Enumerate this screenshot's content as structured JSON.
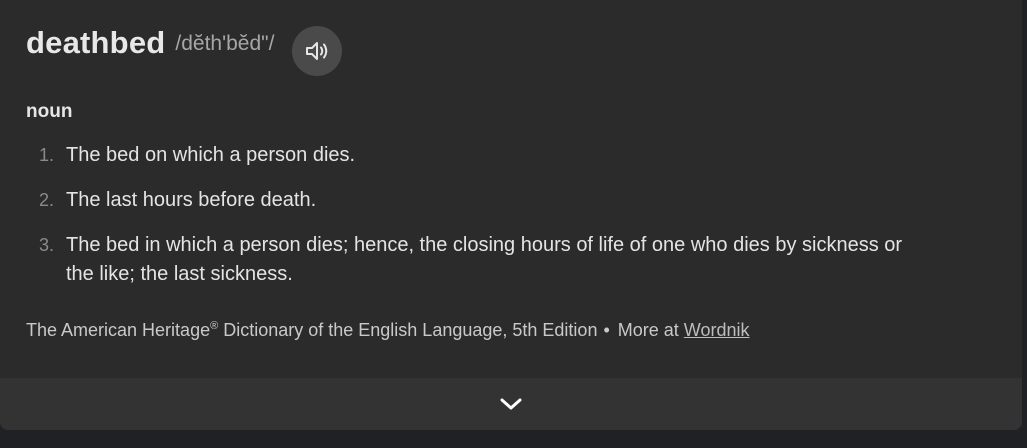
{
  "entry": {
    "word": "deathbed",
    "pronunciation": "/dĕth'bĕd\"/",
    "part_of_speech": "noun"
  },
  "definitions": [
    {
      "number": "1.",
      "text": "The bed on which a person dies."
    },
    {
      "number": "2.",
      "text": "The last hours before death."
    },
    {
      "number": "3.",
      "text": "The bed in which a person dies; hence, the closing hours of life of one who dies by sickness or the like; the last sickness."
    }
  ],
  "source": {
    "name_prefix": "The American Heritage",
    "registered": "®",
    "name_suffix": " Dictionary of the English Language, 5th Edition",
    "bullet": "•",
    "more_label": "More at ",
    "link_text": "Wordnik"
  },
  "icons": {
    "speaker": "speaker-icon",
    "expand": "chevron-down-icon"
  },
  "colors": {
    "background": "#2b2b2b",
    "footer": "#333333",
    "button": "#4a4a4a",
    "text": "#e4e4e4",
    "muted": "#a6a6a6"
  }
}
